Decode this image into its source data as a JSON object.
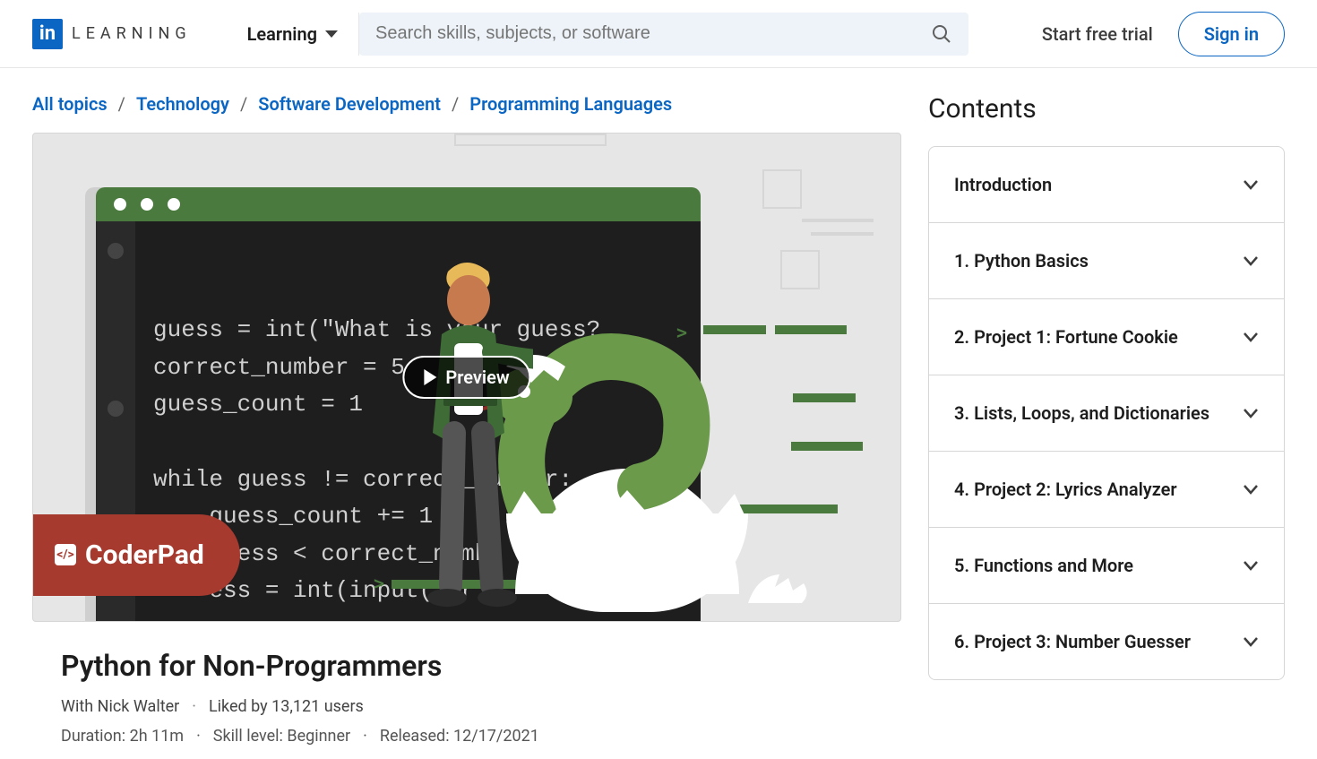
{
  "header": {
    "logo_text": "LEARNING",
    "learning_dd": "Learning",
    "search_placeholder": "Search skills, subjects, or software",
    "trial": "Start free trial",
    "signin": "Sign in"
  },
  "breadcrumbs": [
    "All topics",
    "Technology",
    "Software Development",
    "Programming Languages"
  ],
  "hero": {
    "preview_label": "Preview",
    "coderpad": "CoderPad",
    "code_lines": "guess = int(\"What is your guess?\ncorrect_number = 5\nguess_count = 1\n\nwhile guess != correct_number:\n    guess_count += 1\n    guess < correct_numb\n    ess = int(input(\"Wr"
  },
  "course": {
    "title": "Python for Non-Programmers",
    "with_prefix": "With",
    "author": "Nick Walter",
    "liked_by": "Liked by 13,121 users",
    "duration_label": "Duration:",
    "duration_value": "2h 11m",
    "skill_label": "Skill level:",
    "skill_value": "Beginner",
    "released_label": "Released:",
    "released_value": "12/17/2021"
  },
  "contents": {
    "title": "Contents",
    "items": [
      "Introduction",
      "1. Python Basics",
      "2. Project 1: Fortune Cookie",
      "3. Lists, Loops, and Dictionaries",
      "4. Project 2: Lyrics Analyzer",
      "5. Functions and More",
      "6. Project 3: Number Guesser"
    ]
  }
}
